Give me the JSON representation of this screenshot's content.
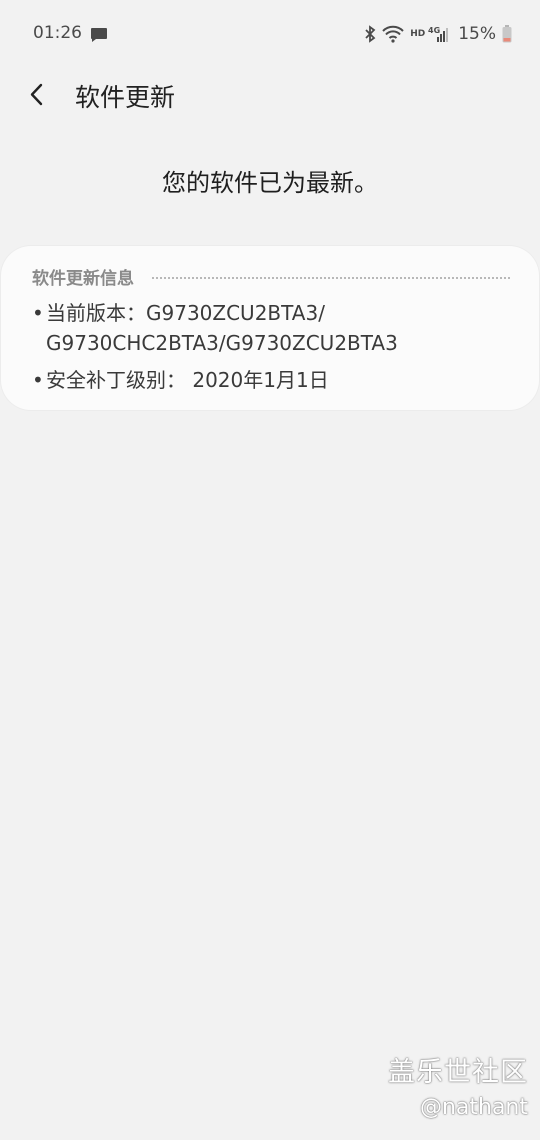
{
  "status_bar": {
    "time": "01:26",
    "battery_percent": "15%",
    "network_label": "HD",
    "signal_type": "4G",
    "icons": [
      "message-icon",
      "bluetooth-icon",
      "wifi-icon",
      "signal-icon",
      "battery-icon"
    ],
    "battery_color": "#e98a7a"
  },
  "header": {
    "title": "软件更新",
    "back_icon": "chevron-left-icon"
  },
  "status_message": "您的软件已为最新。",
  "info_card": {
    "title": "软件更新信息",
    "current_version_line1": "当前版本：G9730ZCU2BTA3/",
    "current_version_line2": "G9730CHC2BTA3/G9730ZCU2BTA3",
    "security_patch": "安全补丁级别： 2020年1月1日",
    "bullet": "•"
  },
  "watermark": {
    "name": "盖乐世社区",
    "handle": "@nathant"
  }
}
